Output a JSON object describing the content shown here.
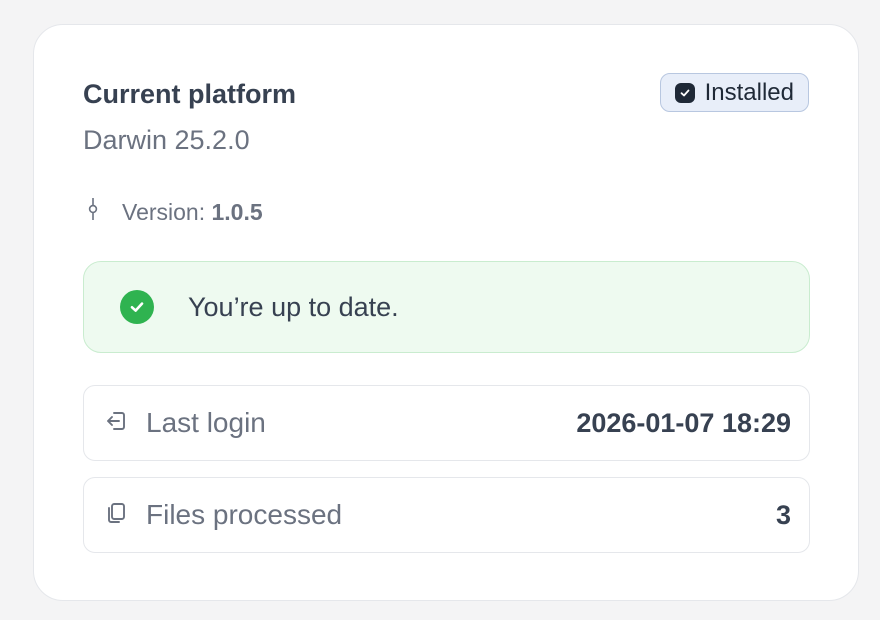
{
  "platform": {
    "title": "Current platform",
    "name": "Darwin 25.2.0",
    "badge": "Installed",
    "version_label": "Version:",
    "version_value": "1.0.5"
  },
  "status": {
    "message": "You’re up to date.",
    "color": "#2fb350"
  },
  "stats": {
    "last_login_label": "Last login",
    "last_login_value": "2026-01-07 18:29",
    "files_label": "Files processed",
    "files_value": "3"
  },
  "icons": {
    "badge": "check-square-icon",
    "version": "git-commit-icon",
    "status": "check-circle-icon",
    "login": "login-icon",
    "files": "copy-files-icon"
  }
}
